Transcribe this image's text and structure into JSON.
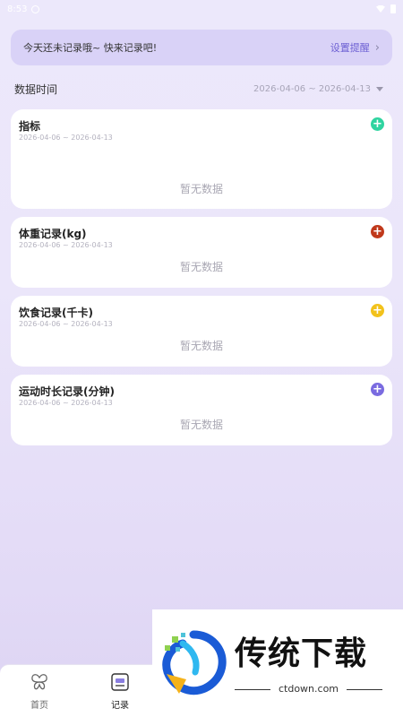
{
  "status_bar": {
    "time": "8:53"
  },
  "banner": {
    "text": "今天还未记录哦~ 快来记录吧!",
    "action": "设置提醒"
  },
  "filter": {
    "label": "数据时间",
    "range": "2026-04-06 ~ 2026-04-13"
  },
  "cards": [
    {
      "title": "指标",
      "date": "2026-04-06 ~ 2026-04-13",
      "empty": "暂无数据",
      "color": "#2fd4a0"
    },
    {
      "title": "体重记录(kg)",
      "date": "2026-04-06 ~ 2026-04-13",
      "empty": "暂无数据",
      "color": "#c0391b"
    },
    {
      "title": "饮食记录(千卡)",
      "date": "2026-04-06 ~ 2026-04-13",
      "empty": "暂无数据",
      "color": "#f2c21b"
    },
    {
      "title": "运动时长记录(分钟)",
      "date": "2026-04-06 ~ 2026-04-13",
      "empty": "暂无数据",
      "color": "#7a6be0"
    }
  ],
  "nav": [
    {
      "label": "首页",
      "icon": "butterfly-icon"
    },
    {
      "label": "记录",
      "icon": "record-icon"
    }
  ],
  "watermark": {
    "title": "传统下载",
    "url": "ctdown.com"
  }
}
